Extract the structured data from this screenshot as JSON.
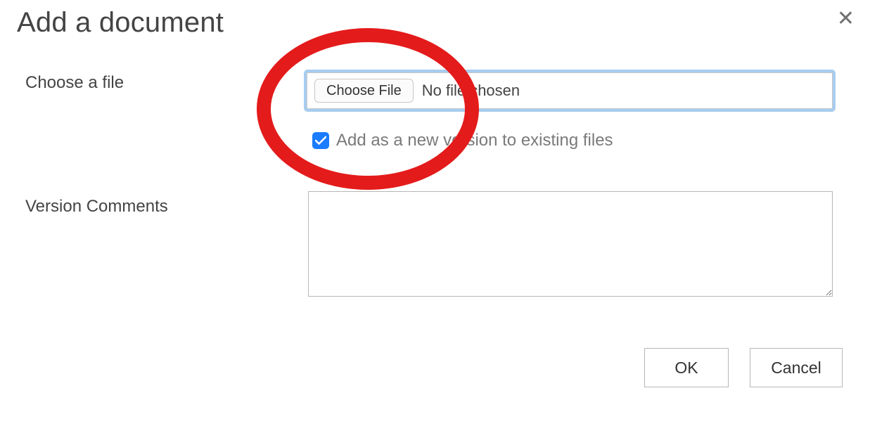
{
  "dialog": {
    "title": "Add a document"
  },
  "fields": {
    "choose_file_label": "Choose a file",
    "choose_file_button": "Choose File",
    "file_status": "No file chosen",
    "new_version_label": "Add as a new version to existing files",
    "new_version_checked": true,
    "version_comments_label": "Version Comments",
    "version_comments_value": ""
  },
  "buttons": {
    "ok": "OK",
    "cancel": "Cancel"
  },
  "annotation": {
    "ellipse_color": "#e41b1b"
  }
}
